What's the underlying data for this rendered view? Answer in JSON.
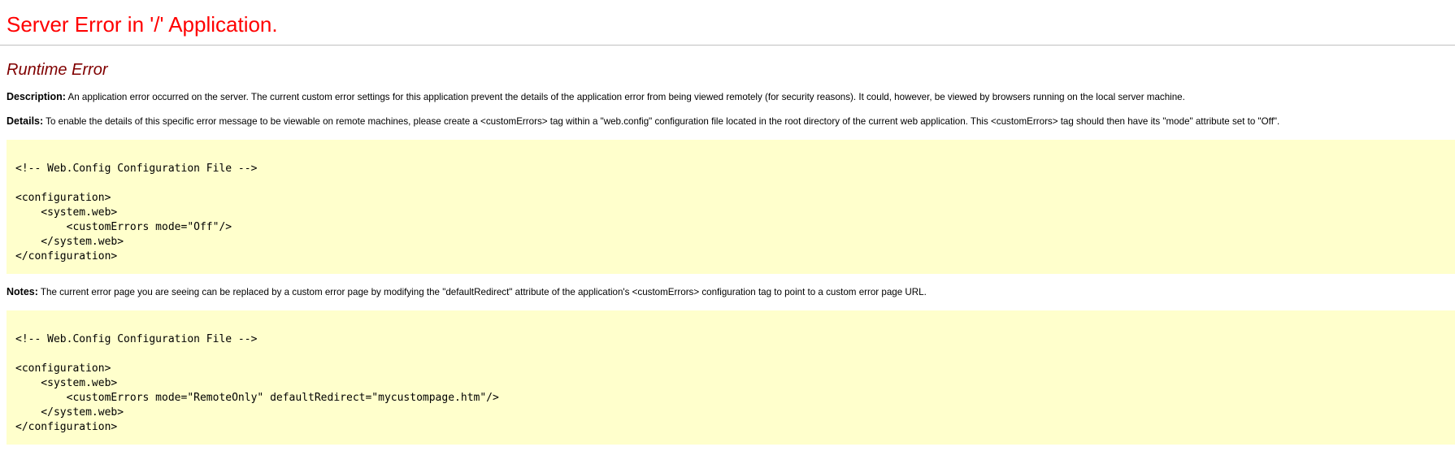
{
  "header": {
    "title": "Server Error in '/' Application.",
    "error_heading": "Runtime Error"
  },
  "description": {
    "label": "Description:",
    "text": " An application error occurred on the server. The current custom error settings for this application prevent the details of the application error from being viewed remotely (for security reasons). It could, however, be viewed by browsers running on the local server machine."
  },
  "details": {
    "label": "Details:",
    "text": " To enable the details of this specific error message to be viewable on remote machines, please create a <customErrors> tag within a \"web.config\" configuration file located in the root directory of the current web application. This <customErrors> tag should then have its \"mode\" attribute set to \"Off\"."
  },
  "code_block_1": {
    "lines": [
      "<!-- Web.Config Configuration File -->",
      "",
      "<configuration>",
      "    <system.web>",
      "        <customErrors mode=\"Off\"/>",
      "    </system.web>",
      "</configuration>"
    ]
  },
  "notes": {
    "label": "Notes:",
    "text": " The current error page you are seeing can be replaced by a custom error page by modifying the \"defaultRedirect\" attribute of the application's <customErrors> configuration tag to point to a custom error page URL."
  },
  "code_block_2": {
    "lines": [
      "<!-- Web.Config Configuration File -->",
      "",
      "<configuration>",
      "    <system.web>",
      "        <customErrors mode=\"RemoteOnly\" defaultRedirect=\"mycustompage.htm\"/>",
      "    </system.web>",
      "</configuration>"
    ]
  },
  "colors": {
    "title": "#ff0000",
    "heading": "#800000",
    "code_background": "#ffffcc",
    "rule": "#c0c0c0"
  }
}
